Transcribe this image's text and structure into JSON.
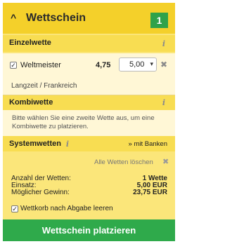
{
  "header": {
    "title": "Wettschein",
    "count": "1",
    "caret": "^"
  },
  "sections": {
    "einzelwette": "Einzelwette",
    "kombiwette": "Kombiwette",
    "systemwetten": "Systemwetten"
  },
  "bet": {
    "selection": "Weltmeister",
    "odds": "4,75",
    "stake": "5,00",
    "event": "Langzeit / Frankreich"
  },
  "kombi_note": "Bitte wählen Sie eine zweite Wette aus, um eine Kombiwette zu platzieren.",
  "system_link": "» mit Banken",
  "clear_all": "Alle Wetten löschen",
  "summary": {
    "count_label": "Anzahl der Wetten:",
    "count_value": "1 Wette",
    "stake_label": "Einsatz:",
    "stake_value": "5,00 EUR",
    "win_label": "Möglicher Gewinn:",
    "win_value": "23,75 EUR"
  },
  "empty_option": "Wettkorb nach Abgabe leeren",
  "submit": "Wettschein platzieren",
  "colors": {
    "accent_yellow": "#f4d02a",
    "panel": "#fbe67a",
    "green": "#2faa4b"
  },
  "icons": [
    "caret-up-icon",
    "info-icon",
    "close-icon",
    "checkbox-checked-icon",
    "dropdown-arrow-icon"
  ]
}
